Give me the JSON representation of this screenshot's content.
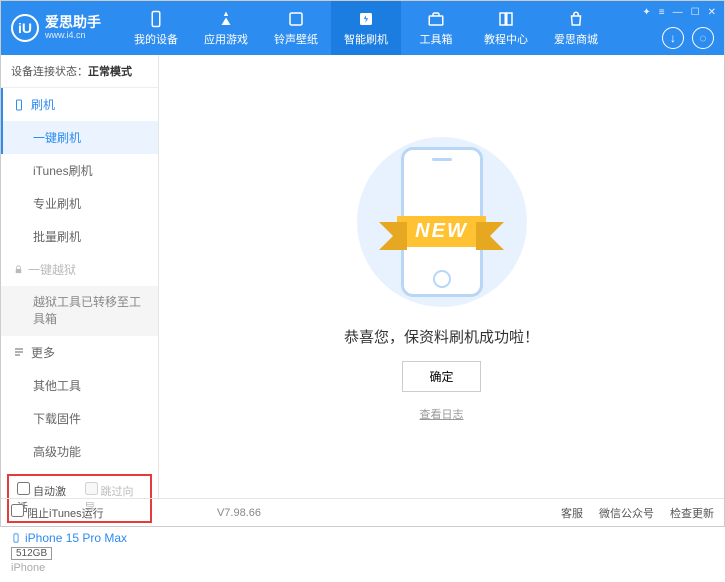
{
  "header": {
    "app_name": "爱思助手",
    "app_url": "www.i4.cn",
    "logo_letter": "iU",
    "nav": [
      {
        "label": "我的设备"
      },
      {
        "label": "应用游戏"
      },
      {
        "label": "铃声壁纸"
      },
      {
        "label": "智能刷机"
      },
      {
        "label": "工具箱"
      },
      {
        "label": "教程中心"
      },
      {
        "label": "爱思商城"
      }
    ],
    "win_controls": [
      "✦",
      "≡",
      "—",
      "☐",
      "✕"
    ]
  },
  "sidebar": {
    "conn_label": "设备连接状态：",
    "conn_value": "正常模式",
    "section_flash": "刷机",
    "items_flash": [
      "一键刷机",
      "iTunes刷机",
      "专业刷机",
      "批量刷机"
    ],
    "section_jailbreak": "一键越狱",
    "jailbreak_note": "越狱工具已转移至工具箱",
    "section_more": "更多",
    "items_more": [
      "其他工具",
      "下载固件",
      "高级功能"
    ],
    "check_auto": "自动激活",
    "check_skip": "跳过向导",
    "device_name": "iPhone 15 Pro Max",
    "device_storage": "512GB",
    "device_type": "iPhone"
  },
  "main": {
    "ribbon": "NEW",
    "success": "恭喜您，保资料刷机成功啦！",
    "ok": "确定",
    "log": "查看日志"
  },
  "footer": {
    "block_itunes": "阻止iTunes运行",
    "version": "V7.98.66",
    "links": [
      "客服",
      "微信公众号",
      "检查更新"
    ]
  }
}
